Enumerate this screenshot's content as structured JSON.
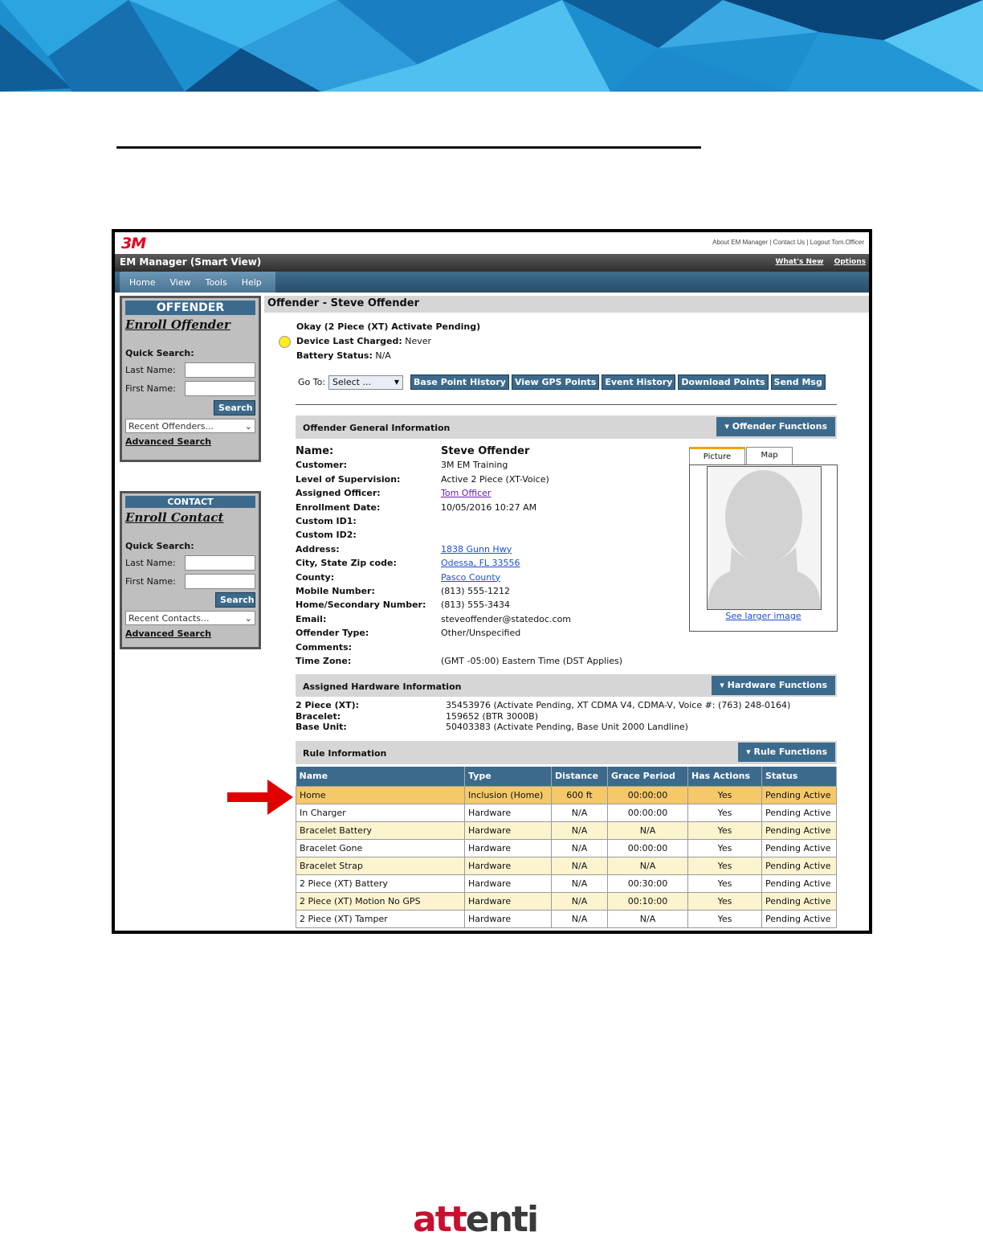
{
  "app": {
    "brand": "3M",
    "top_links": "About EM Manager | Contact Us | Logout Tom.Officer",
    "title": "EM Manager (Smart View)",
    "whats_new": "What's New",
    "options": "Options",
    "menu": [
      "Home",
      "View",
      "Tools",
      "Help"
    ]
  },
  "sidebar": {
    "offender": {
      "header": "OFFENDER",
      "enroll": "Enroll Offender",
      "quick_search": "Quick Search:",
      "last_name": "Last Name:",
      "first_name": "First Name:",
      "search_btn": "Search",
      "recent": "Recent Offenders...",
      "advanced": "Advanced Search"
    },
    "contact": {
      "header": "CONTACT",
      "enroll": "Enroll Contact",
      "quick_search": "Quick Search:",
      "last_name": "Last Name:",
      "first_name": "First Name:",
      "search_btn": "Search",
      "recent": "Recent Contacts...",
      "advanced": "Advanced Search"
    }
  },
  "main": {
    "heading": "Offender - Steve Offender",
    "status_line": "Okay (2 Piece (XT) Activate Pending)",
    "charged_label": "Device Last Charged:",
    "charged_value": "Never",
    "battery_label": "Battery Status:",
    "battery_value": "N/A",
    "status_color": "#ffec1a",
    "goto_label": "Go To:",
    "goto_select": "Select ...",
    "actions": [
      "Base Point History",
      "View GPS Points",
      "Event History",
      "Download Points",
      "Send Msg"
    ],
    "general_header": "Offender General Information",
    "offender_functions": "Offender Functions",
    "fields": [
      {
        "label": "Name:",
        "value": ""
      },
      {
        "label": "Customer:",
        "value": "3M EM Training"
      },
      {
        "label": "Level of Supervision:",
        "value": "Active 2 Piece (XT-Voice)"
      },
      {
        "label": "Assigned Officer:",
        "value": "Tom Officer"
      },
      {
        "label": "Enrollment Date:",
        "value": "10/05/2016 10:27 AM"
      },
      {
        "label": "Custom ID1:",
        "value": ""
      },
      {
        "label": "Custom ID2:",
        "value": ""
      },
      {
        "label": "Address:",
        "value": "1838 Gunn Hwy"
      },
      {
        "label": "City, State Zip code:",
        "value": "Odessa, FL 33556"
      },
      {
        "label": "County:",
        "value": "Pasco County"
      },
      {
        "label": "Mobile Number:",
        "value": "(813) 555-1212"
      },
      {
        "label": "Home/Secondary Number:",
        "value": "(813) 555-3434"
      },
      {
        "label": "Email:",
        "value": "steveoffender@statedoc.com"
      },
      {
        "label": "Offender Type:",
        "value": "Other/Unspecified"
      },
      {
        "label": "Comments:",
        "value": ""
      },
      {
        "label": "Time Zone:",
        "value": "(GMT -05:00) Eastern Time (DST Applies)"
      }
    ],
    "offender_name": "Steve Offender",
    "tab_picture": "Picture",
    "tab_map": "Map",
    "see_larger": "See larger image",
    "hardware_header": "Assigned Hardware Information",
    "hardware_functions": "Hardware Functions",
    "hardware": [
      {
        "label": "2 Piece (XT):",
        "value": "35453976 (Activate Pending, XT CDMA V4, CDMA-V, Voice #: (763) 248-0164)"
      },
      {
        "label": "Bracelet:",
        "value": "159652 (BTR 3000B)"
      },
      {
        "label": "Base Unit:",
        "value": "50403383 (Activate Pending, Base Unit 2000 Landline)"
      }
    ],
    "rule_header": "Rule Information",
    "rule_functions": "Rule Functions",
    "rule_columns": [
      "Name",
      "Type",
      "Distance",
      "Grace Period",
      "Has Actions",
      "Status"
    ],
    "rules": [
      [
        "Home",
        "Inclusion (Home)",
        "600 ft",
        "00:00:00",
        "Yes",
        "Pending Active"
      ],
      [
        "In Charger",
        "Hardware",
        "N/A",
        "00:00:00",
        "Yes",
        "Pending Active"
      ],
      [
        "Bracelet Battery",
        "Hardware",
        "N/A",
        "N/A",
        "Yes",
        "Pending Active"
      ],
      [
        "Bracelet Gone",
        "Hardware",
        "N/A",
        "00:00:00",
        "Yes",
        "Pending Active"
      ],
      [
        "Bracelet Strap",
        "Hardware",
        "N/A",
        "N/A",
        "Yes",
        "Pending Active"
      ],
      [
        "2 Piece (XT) Battery",
        "Hardware",
        "N/A",
        "00:30:00",
        "Yes",
        "Pending Active"
      ],
      [
        "2 Piece (XT) Motion No GPS",
        "Hardware",
        "N/A",
        "00:10:00",
        "Yes",
        "Pending Active"
      ],
      [
        "2 Piece (XT) Tamper",
        "Hardware",
        "N/A",
        "N/A",
        "Yes",
        "Pending Active"
      ]
    ]
  },
  "footer": {
    "brand_part1": "att",
    "brand_part2": "enti"
  },
  "colors": {
    "accent": "#3c6a8c",
    "highlight_row": "#f5c96a",
    "alt_row": "#fbf4cf",
    "arrow": "#e00000",
    "brand_red": "#c8102e"
  }
}
